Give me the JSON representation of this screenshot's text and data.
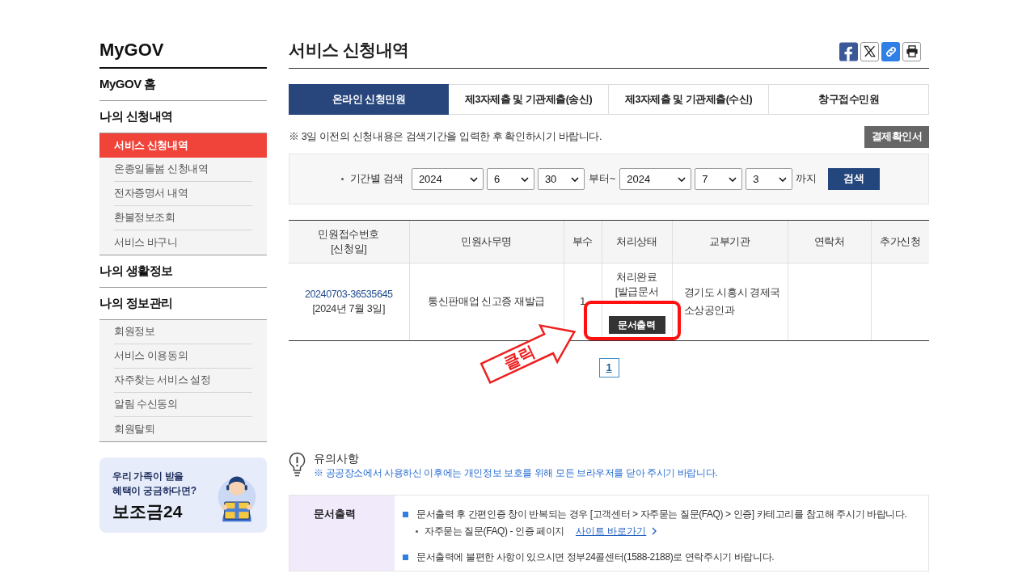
{
  "sidebar": {
    "title": "MyGOV",
    "sections": [
      {
        "label": "MyGOV 홈"
      },
      {
        "label": "나의 신청내역",
        "children": [
          {
            "label": "서비스 신청내역",
            "selected": true
          },
          {
            "label": "온종일돌봄 신청내역",
            "selected": false
          },
          {
            "label": "전자증명서 내역",
            "selected": false
          },
          {
            "label": "환불정보조회",
            "selected": false
          },
          {
            "label": "서비스 바구니",
            "selected": false
          }
        ]
      },
      {
        "label": "나의 생활정보"
      },
      {
        "label": "나의 정보관리",
        "children": [
          {
            "label": "회원정보",
            "selected": false
          },
          {
            "label": "서비스 이용동의",
            "selected": false
          },
          {
            "label": "자주찾는 서비스 설정",
            "selected": false
          },
          {
            "label": "알림 수신동의",
            "selected": false
          },
          {
            "label": "회원탈퇴",
            "selected": false
          }
        ]
      }
    ],
    "banner": {
      "lines": [
        "우리 가족이 받을",
        "혜택이 궁금하다면?"
      ],
      "brand": "보조금24"
    }
  },
  "page": {
    "title": "서비스 신청내역"
  },
  "tabs": [
    {
      "label": "온라인 신청민원",
      "selected": true
    },
    {
      "label": "제3자제출 및 기관제출(송신)",
      "selected": false
    },
    {
      "label": "제3자제출 및 기관제출(수신)",
      "selected": false
    },
    {
      "label": "창구접수민원",
      "selected": false
    }
  ],
  "notice": "※ 3일 이전의 신청내용은 검색기간을 입력한 후 확인하시기 바랍니다.",
  "receipt_button": "결제확인서",
  "search": {
    "label": "기간별 검색",
    "from": [
      "2024",
      "6",
      "30"
    ],
    "from_suffix": "부터~",
    "to": [
      "2024",
      "7",
      "3"
    ],
    "to_suffix": "까지",
    "button": "검색"
  },
  "table": {
    "columns": [
      {
        "label": "민원접수번호",
        "sublabel": "[신청일]"
      },
      {
        "label": "민원사무명"
      },
      {
        "label": "부수"
      },
      {
        "label": "처리상태"
      },
      {
        "label": "교부기관"
      },
      {
        "label": "연락처"
      },
      {
        "label": "추가신청"
      }
    ],
    "rows": [
      {
        "receipt_no": "20240703-36535645",
        "date": "[2024년 7월 3일]",
        "service": "통신판매업 신고증 재발급",
        "copies": "1",
        "status": [
          "처리완료",
          "[발급문서"
        ],
        "print_button": "문서출력",
        "agency": "경기도 시흥시 경제국 소상공인과"
      }
    ]
  },
  "pagination": [
    {
      "label": "1",
      "selected": true
    }
  ],
  "callout": {
    "label": "클릭"
  },
  "notes": {
    "title": "유의사항",
    "message": "※ 공공장소에서 사용하신 이후에는 개인정보 보호를 위해 모든 브라우저를 닫아 주시기 바랍니다."
  },
  "info": {
    "heading": "문서출력",
    "items": [
      {
        "text": "문서출력 후 간편인증 창이 반복되는 경우 [고객센터 > 자주묻는 질문(FAQ) > 인증] 카테고리를 참고해 주시기 바랍니다.",
        "sub": {
          "text": "자주묻는 질문(FAQ) - 인증 페이지",
          "link": "사이트 바로가기"
        }
      },
      {
        "text": "문서출력에 불편한 사항이 있으시면 정부24콜센터(1588-2188)로 연락주시기 바랍니다."
      }
    ]
  }
}
